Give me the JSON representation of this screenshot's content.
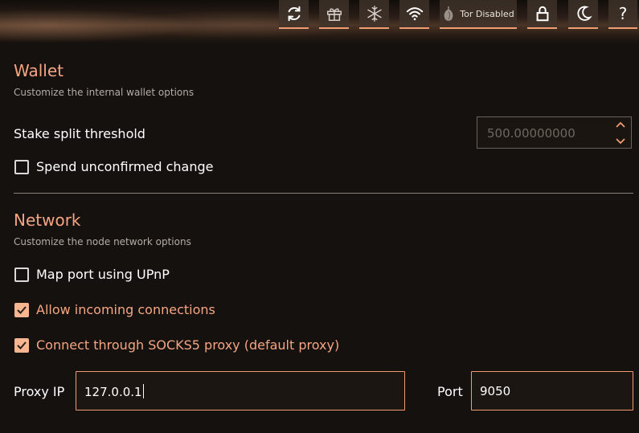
{
  "toolbar": {
    "buttons": [
      {
        "name": "refresh-icon"
      },
      {
        "name": "gift-icon"
      },
      {
        "name": "snowflake-icon"
      },
      {
        "name": "wifi-icon"
      },
      {
        "name": "tor-onion-icon",
        "label": "Tor Disabled"
      },
      {
        "name": "lock-icon"
      },
      {
        "name": "moon-icon"
      },
      {
        "name": "help-icon",
        "label": "?"
      }
    ],
    "accent": "#f19b73"
  },
  "wallet": {
    "title": "Wallet",
    "subtitle": "Customize the internal wallet options",
    "stake_split_label": "Stake split threshold",
    "stake_split_value": "500.00000000",
    "spend_unconfirmed_label": "Spend unconfirmed change",
    "spend_unconfirmed_checked": false
  },
  "network": {
    "title": "Network",
    "subtitle": "Customize the node network options",
    "upnp_label": "Map port using UPnP",
    "upnp_checked": false,
    "incoming_label": "Allow incoming connections",
    "incoming_checked": true,
    "socks_label": "Connect through SOCKS5 proxy (default proxy)",
    "socks_checked": true,
    "proxy_ip_label": "Proxy IP",
    "proxy_ip_value": "127.0.0.1",
    "port_label": "Port",
    "port_value": "9050"
  },
  "colors": {
    "accent": "#f5a583",
    "checkbox_fill": "#f7b592",
    "background": "#15110e"
  }
}
